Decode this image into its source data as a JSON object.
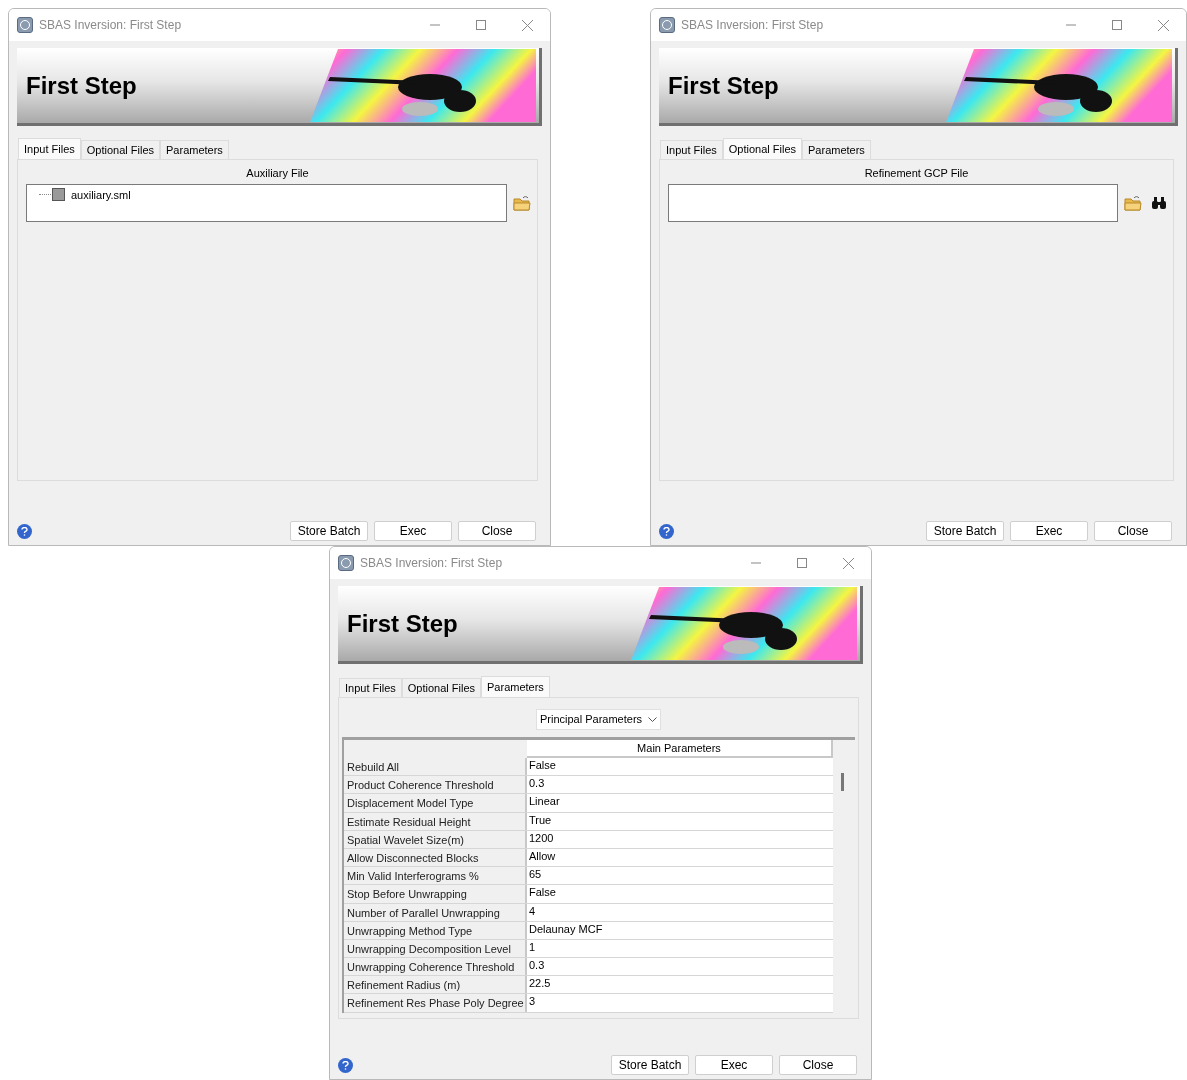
{
  "windows": [
    {
      "title": "SBAS Inversion: First Step",
      "header": "First Step",
      "tabs": [
        {
          "label": "Input Files",
          "selected": true
        },
        {
          "label": "Optional Files",
          "selected": false
        },
        {
          "label": "Parameters",
          "selected": false
        }
      ],
      "panel": {
        "kind": "file",
        "label": "Auxiliary File",
        "files": [
          "auxiliary.sml"
        ],
        "actions": [
          {
            "kind": "browse"
          }
        ]
      },
      "buttons": [
        "Store Batch",
        "Exec",
        "Close"
      ]
    },
    {
      "title": "SBAS Inversion: First Step",
      "header": "First Step",
      "tabs": [
        {
          "label": "Input Files",
          "selected": false
        },
        {
          "label": "Optional Files",
          "selected": true
        },
        {
          "label": "Parameters",
          "selected": false
        }
      ],
      "panel": {
        "kind": "file",
        "label": "Refinement GCP File",
        "actions": [
          {
            "kind": "browse"
          },
          {
            "kind": "find"
          }
        ]
      },
      "buttons": [
        "Store Batch",
        "Exec",
        "Close"
      ]
    },
    {
      "title": "SBAS Inversion: First Step",
      "header": "First Step",
      "tabs": [
        {
          "label": "Input Files",
          "selected": false
        },
        {
          "label": "Optional Files",
          "selected": false
        },
        {
          "label": "Parameters",
          "selected": true
        }
      ],
      "panel": {
        "kind": "params",
        "dropdown": "Principal Parameters",
        "column": "Main Parameters",
        "rows": [
          {
            "name": "Rebuild All",
            "value": "False"
          },
          {
            "name": "Product Coherence Threshold",
            "value": "0.3"
          },
          {
            "name": "Displacement Model Type",
            "value": "Linear"
          },
          {
            "name": "Estimate Residual Height",
            "value": "True"
          },
          {
            "name": "Spatial Wavelet Size(m)",
            "value": "1200"
          },
          {
            "name": "Allow Disconnected Blocks",
            "value": "Allow"
          },
          {
            "name": "Min Valid Interferograms %",
            "value": "65"
          },
          {
            "name": "Stop Before Unwrapping",
            "value": "False"
          },
          {
            "name": "Number of Parallel Unwrapping",
            "value": "4"
          },
          {
            "name": "Unwrapping Method Type",
            "value": "Delaunay MCF"
          },
          {
            "name": "Unwrapping Decomposition Level",
            "value": "1"
          },
          {
            "name": "Unwrapping Coherence Threshold",
            "value": "0.3"
          },
          {
            "name": "Refinement Radius (m)",
            "value": "22.5"
          },
          {
            "name": "Refinement Res Phase Poly Degree",
            "value": "3"
          }
        ]
      },
      "buttons": [
        "Store Batch",
        "Exec",
        "Close"
      ]
    }
  ]
}
